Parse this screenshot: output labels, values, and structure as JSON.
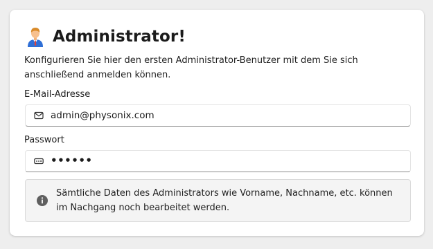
{
  "card": {
    "title": "Administrator!",
    "title_icon": "businessman-icon",
    "description": "Konfigurieren Sie hier den ersten Administrator-Benutzer mit dem Sie sich anschließend anmelden können."
  },
  "email": {
    "label": "E-Mail-Adresse",
    "icon": "envelope-icon",
    "value": "admin@physonix.com"
  },
  "password": {
    "label": "Passwort",
    "icon": "password-icon",
    "value": "••••••"
  },
  "info": {
    "icon": "info-icon",
    "text": "Sämtliche Daten des Administrators wie Vorname, Nachname, etc. können im Nachgang noch bearbeitet werden."
  },
  "colors": {
    "background": "#eeeeee",
    "card": "#ffffff",
    "info_background": "#f4f4f4",
    "info_icon": "#5f5f5f",
    "field_underline": "#8a8a8a"
  }
}
